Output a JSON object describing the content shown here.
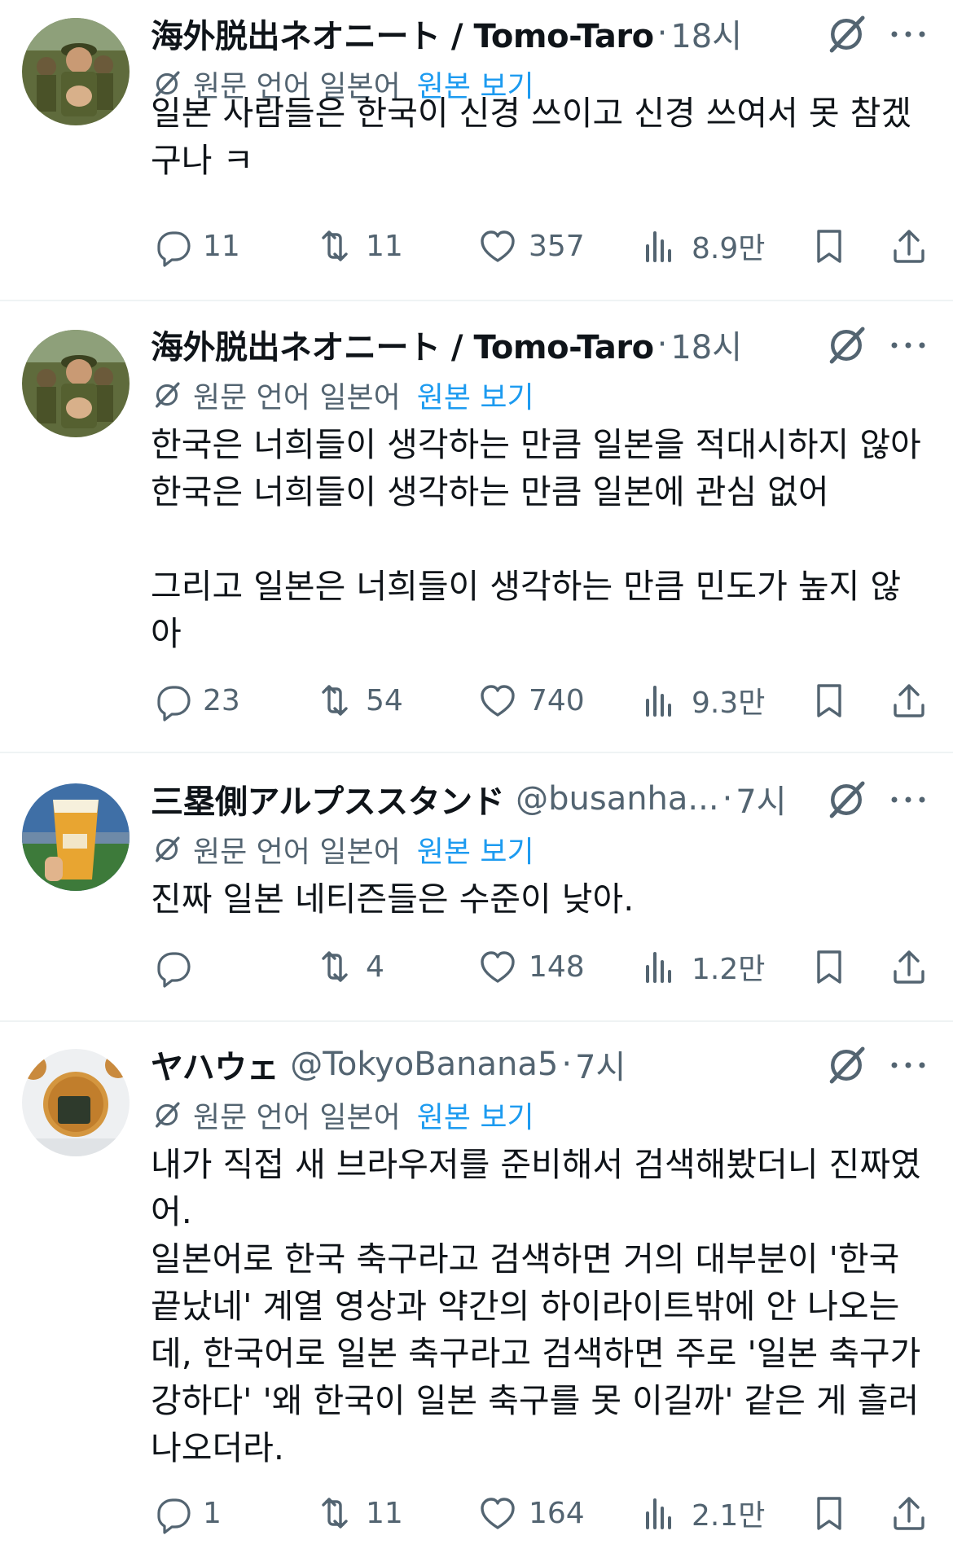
{
  "tweets": [
    {
      "name": "海外脱出ネオニート / Tomo-Taro",
      "handle": "",
      "time": "18시",
      "translate_label": "원문 언어 일본어",
      "translate_link": "원본 보기",
      "body": "일본 사람들은 한국이 신경 쓰이고 신경 쓰여서 못 참겠\n구나 ㅋ",
      "replies": "11",
      "reposts": "11",
      "likes": "357",
      "views": "8.9만",
      "avatar": "soldier-photo"
    },
    {
      "name": "海外脱出ネオニート / Tomo-Taro",
      "handle": "",
      "time": "18시",
      "translate_label": "원문 언어 일본어",
      "translate_link": "원본 보기",
      "body": "한국은 너희들이 생각하는 만큼 일본을 적대시하지 않아\n한국은 너희들이 생각하는 만큼 일본에 관심 없어\n\n그리고 일본은 너희들이 생각하는 만큼 민도가 높지 않\n아",
      "replies": "23",
      "reposts": "54",
      "likes": "740",
      "views": "9.3만",
      "avatar": "soldier-photo"
    },
    {
      "name": "三塁側アルプススタンド",
      "handle": "@busanha...",
      "time": "7시",
      "translate_label": "원문 언어 일본어",
      "translate_link": "원본 보기",
      "body": "진짜 일본 네티즌들은 수준이 낮아.",
      "replies": "",
      "reposts": "4",
      "likes": "148",
      "views": "1.2만",
      "avatar": "beer-cup-photo"
    },
    {
      "name": "ヤハウェ",
      "handle": "@TokyoBanana5",
      "time": "7시",
      "translate_label": "원문 언어 일본어",
      "translate_link": "원본 보기",
      "body": "내가 직접 새 브라우저를 준비해서 검색해봤더니 진짜였\n어.\n일본어로 한국 축구라고 검색하면 거의 대부분이 '한국\n끝났네' 계열 영상과 약간의 하이라이트밖에 안 나오는\n데, 한국어로 일본 축구라고 검색하면 주로 '일본 축구가\n강하다' '왜 한국이 일본 축구를 못 이길까' 같은 게 흘러\n나오더라.",
      "replies": "1",
      "reposts": "11",
      "likes": "164",
      "views": "2.1만",
      "avatar": "rice-cracker-photo"
    }
  ],
  "icons": {
    "reply": "reply-icon",
    "repost": "repost-icon",
    "like": "heart-icon",
    "views": "views-icon",
    "bookmark": "bookmark-icon",
    "share": "share-icon",
    "grok": "grok-icon",
    "more": "more-icon"
  },
  "colors": {
    "text": "#0f1419",
    "secondary": "#536471",
    "link": "#1d9bf0",
    "divider": "#eff3f4"
  }
}
